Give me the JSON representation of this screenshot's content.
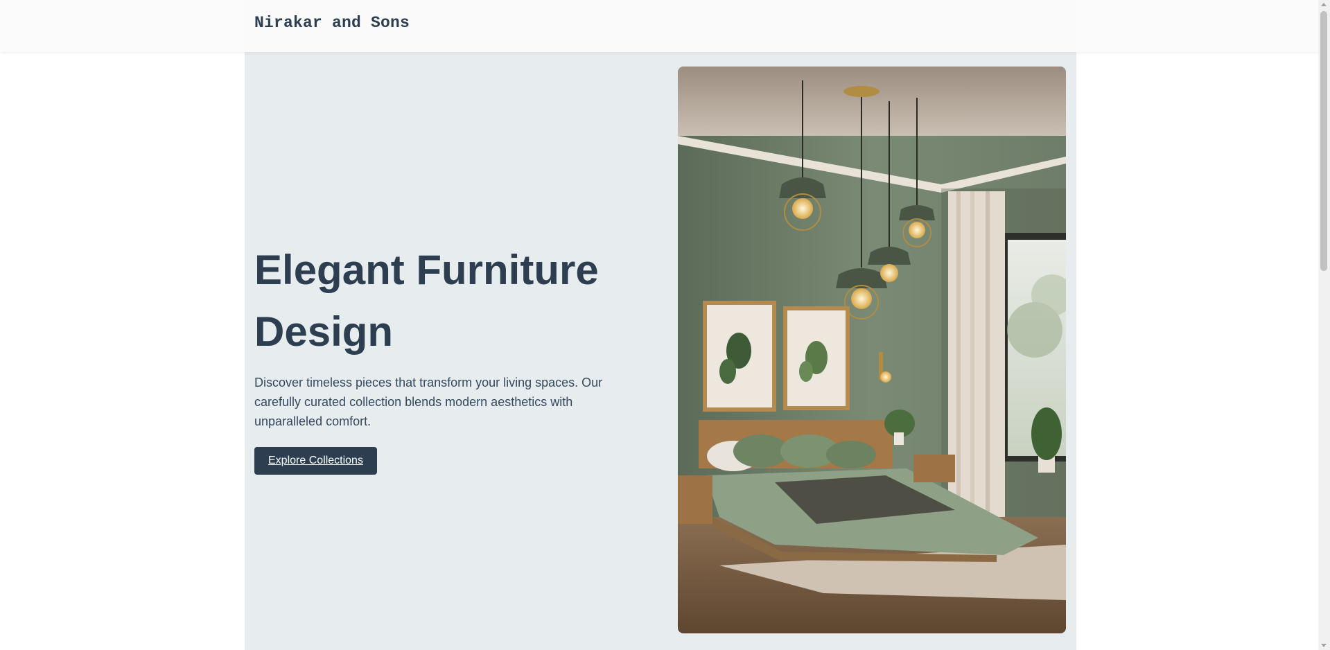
{
  "header": {
    "brand": "Nirakar and Sons"
  },
  "hero": {
    "title": "Elegant Furniture Design",
    "description": "Discover timeless pieces that transform your living spaces. Our carefully curated collection blends modern aesthetics with unparalleled comfort.",
    "cta_label": "Explore Collections"
  },
  "colors": {
    "primary": "#2c3e50",
    "hero_bg": "#e7ecef",
    "header_bg": "#fafafa"
  }
}
